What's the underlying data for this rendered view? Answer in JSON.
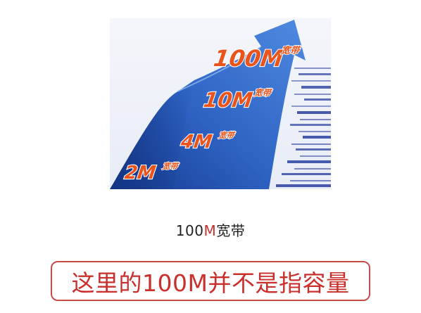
{
  "banner": {
    "tiers": [
      {
        "speed": "2M",
        "unit": "宽带"
      },
      {
        "speed": "4M",
        "unit": "宽带"
      },
      {
        "speed": "10M",
        "unit": "宽带"
      },
      {
        "speed": "100M",
        "unit": "宽带"
      }
    ],
    "colors": {
      "arrow_dark": "#1a3f96",
      "arrow_light": "#3b74d4",
      "label": "#e8541c",
      "stripe": "#2a3f9c"
    }
  },
  "caption": {
    "prefix": "100",
    "accent": "M",
    "suffix": "宽带"
  },
  "notice": {
    "text": "这里的100M并不是指容量"
  },
  "colors": {
    "accent_red": "#c9302c",
    "box_border": "#c94a4a"
  }
}
